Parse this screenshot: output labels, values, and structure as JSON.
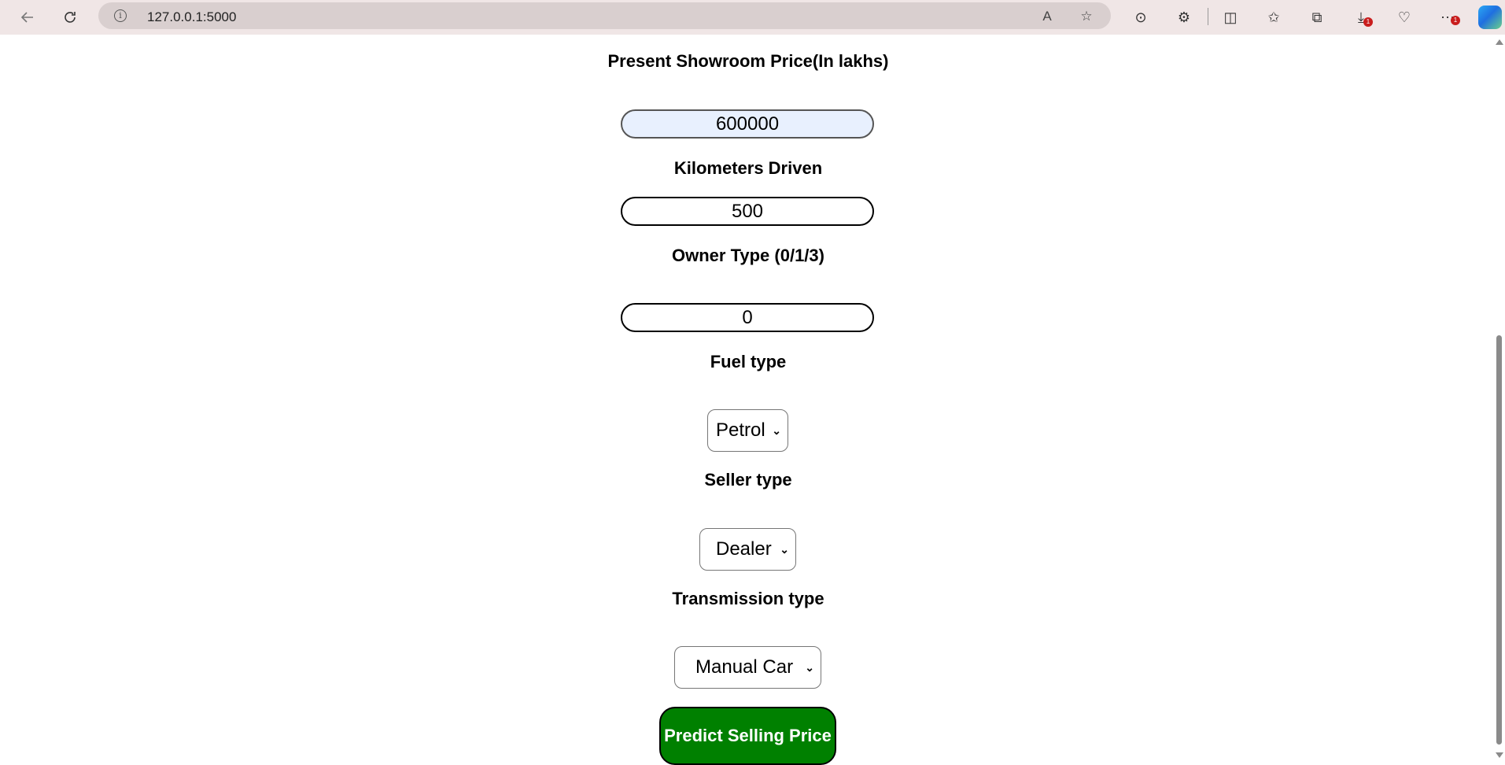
{
  "browser": {
    "url": "127.0.0.1:5000",
    "downloads_badge": "1",
    "more_badge": "1"
  },
  "form": {
    "showroom_price": {
      "label": "Present Showroom Price(In lakhs)",
      "value": "600000"
    },
    "kms_driven": {
      "label": "Kilometers Driven",
      "value": "500"
    },
    "owner_type": {
      "label": "Owner Type (0/1/3)",
      "value": "0"
    },
    "fuel_type": {
      "label": "Fuel type",
      "selected": "Petrol"
    },
    "seller_type": {
      "label": "Seller type",
      "selected": "Dealer"
    },
    "transmission_type": {
      "label": "Transmission type",
      "selected": "Manual Car"
    },
    "submit_label": "Predict Selling Price"
  },
  "colors": {
    "submit_bg": "#008000",
    "autofill_bg": "#e8f0fe"
  }
}
